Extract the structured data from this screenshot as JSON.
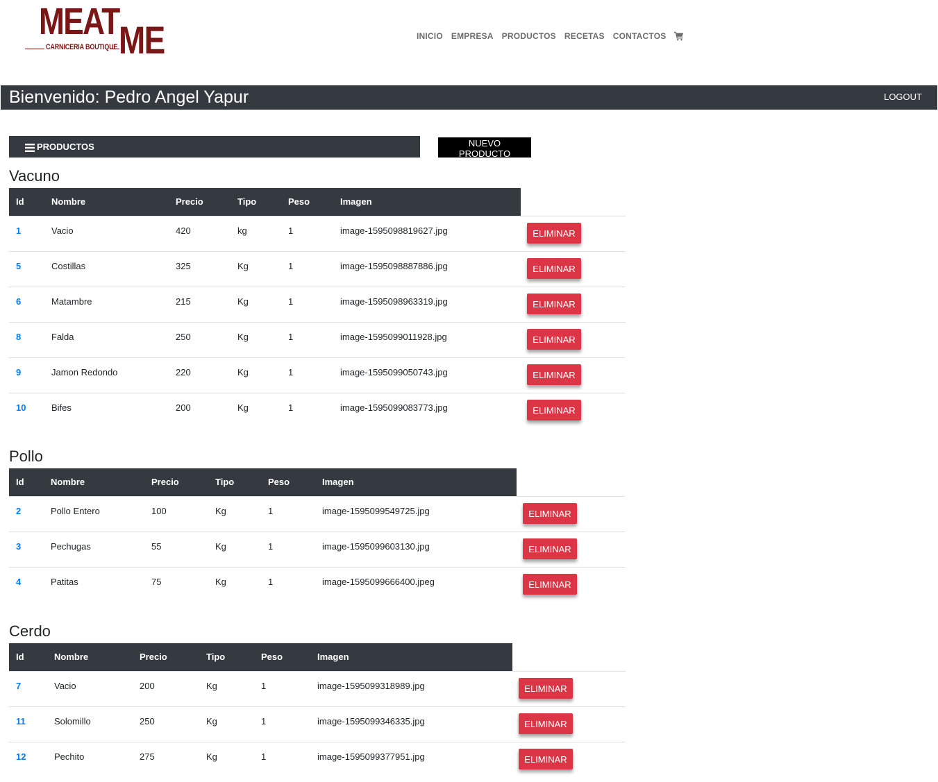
{
  "brand": {
    "logo_top": "MEAT",
    "logo_bottom": "ME",
    "logo_sub": "CARNICERIA BOUTIQUE",
    "color": "#7a1716"
  },
  "nav": {
    "items": [
      "INICIO",
      "EMPRESA",
      "PRODUCTOS",
      "RECETAS",
      "CONTACTOS"
    ],
    "cart_icon": "cart-icon"
  },
  "welcome": {
    "title": "Bienvenido: Pedro Angel Yapur",
    "logout": "LOGOUT"
  },
  "toolbar": {
    "productos_label": "PRODUCTOS",
    "nuevo_label": "NUEVO PRODUCTO"
  },
  "columns": [
    "Id",
    "Nombre",
    "Precio",
    "Tipo",
    "Peso",
    "Imagen"
  ],
  "delete_label": "ELIMINAR",
  "sections": [
    {
      "title": "Vacuno",
      "rows": [
        {
          "id": "1",
          "nombre": "Vacio",
          "precio": "420",
          "tipo": "kg",
          "peso": "1",
          "imagen": "image-1595098819627.jpg"
        },
        {
          "id": "5",
          "nombre": "Costillas",
          "precio": "325",
          "tipo": "Kg",
          "peso": "1",
          "imagen": "image-1595098887886.jpg"
        },
        {
          "id": "6",
          "nombre": "Matambre",
          "precio": "215",
          "tipo": "Kg",
          "peso": "1",
          "imagen": "image-1595098963319.jpg"
        },
        {
          "id": "8",
          "nombre": "Falda",
          "precio": "250",
          "tipo": "Kg",
          "peso": "1",
          "imagen": "image-1595099011928.jpg"
        },
        {
          "id": "9",
          "nombre": "Jamon Redondo",
          "precio": "220",
          "tipo": "Kg",
          "peso": "1",
          "imagen": "image-1595099050743.jpg"
        },
        {
          "id": "10",
          "nombre": "Bifes",
          "precio": "200",
          "tipo": "Kg",
          "peso": "1",
          "imagen": "image-1595099083773.jpg"
        }
      ]
    },
    {
      "title": "Pollo",
      "rows": [
        {
          "id": "2",
          "nombre": "Pollo Entero",
          "precio": "100",
          "tipo": "Kg",
          "peso": "1",
          "imagen": "image-1595099549725.jpg"
        },
        {
          "id": "3",
          "nombre": "Pechugas",
          "precio": "55",
          "tipo": "Kg",
          "peso": "1",
          "imagen": "image-1595099603130.jpg"
        },
        {
          "id": "4",
          "nombre": "Patitas",
          "precio": "75",
          "tipo": "Kg",
          "peso": "1",
          "imagen": "image-1595099666400.jpeg"
        }
      ]
    },
    {
      "title": "Cerdo",
      "rows": [
        {
          "id": "7",
          "nombre": "Vacio",
          "precio": "200",
          "tipo": "Kg",
          "peso": "1",
          "imagen": "image-1595099318989.jpg"
        },
        {
          "id": "11",
          "nombre": "Solomillo",
          "precio": "250",
          "tipo": "Kg",
          "peso": "1",
          "imagen": "image-1595099346335.jpg"
        },
        {
          "id": "12",
          "nombre": "Pechito",
          "precio": "275",
          "tipo": "Kg",
          "peso": "1",
          "imagen": "image-1595099377951.jpg"
        }
      ]
    }
  ]
}
